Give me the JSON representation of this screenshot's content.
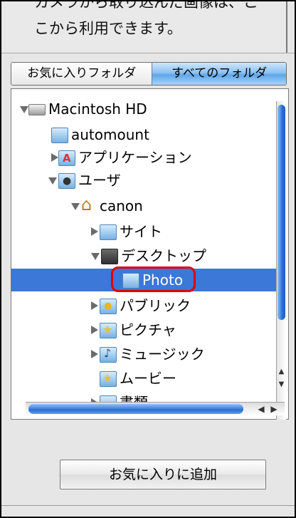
{
  "instructions": {
    "line1": "カメラから取り込んだ画像は、こ",
    "line2": "こから利用できます。"
  },
  "tabs": {
    "favorites": "お気に入りフォルダ",
    "all": "すべてのフォルダ",
    "selected": "すべてのフォルダ"
  },
  "tree": {
    "items": [
      {
        "label": "Macintosh HD",
        "icon": "hard-drive-icon",
        "expander": "open"
      },
      {
        "label": "automount",
        "icon": "folder-icon",
        "expander": "none"
      },
      {
        "label": "アプリケーション",
        "icon": "applications-folder-icon",
        "expander": "closed"
      },
      {
        "label": "ユーザ",
        "icon": "users-folder-icon",
        "expander": "open"
      },
      {
        "label": "canon",
        "icon": "home-icon",
        "expander": "open"
      },
      {
        "label": "サイト",
        "icon": "sites-folder-icon",
        "expander": "closed"
      },
      {
        "label": "デスクトップ",
        "icon": "desktop-folder-icon",
        "expander": "open"
      },
      {
        "label": "Photo",
        "icon": "folder-icon",
        "expander": "none",
        "selected": true
      },
      {
        "label": "パブリック",
        "icon": "public-folder-icon",
        "expander": "closed"
      },
      {
        "label": "ピクチャ",
        "icon": "pictures-folder-icon",
        "expander": "closed"
      },
      {
        "label": "ミュージック",
        "icon": "music-folder-icon",
        "expander": "closed"
      },
      {
        "label": "ムービー",
        "icon": "movies-folder-icon",
        "expander": "none"
      },
      {
        "label": "書類",
        "icon": "documents-folder-icon",
        "expander": "closed"
      }
    ]
  },
  "buttons": {
    "add_favorite": "お気に入りに追加"
  },
  "colors": {
    "selection": "#3b78d8",
    "highlight_ring": "#e00000",
    "accent": "#2a6fd6"
  }
}
